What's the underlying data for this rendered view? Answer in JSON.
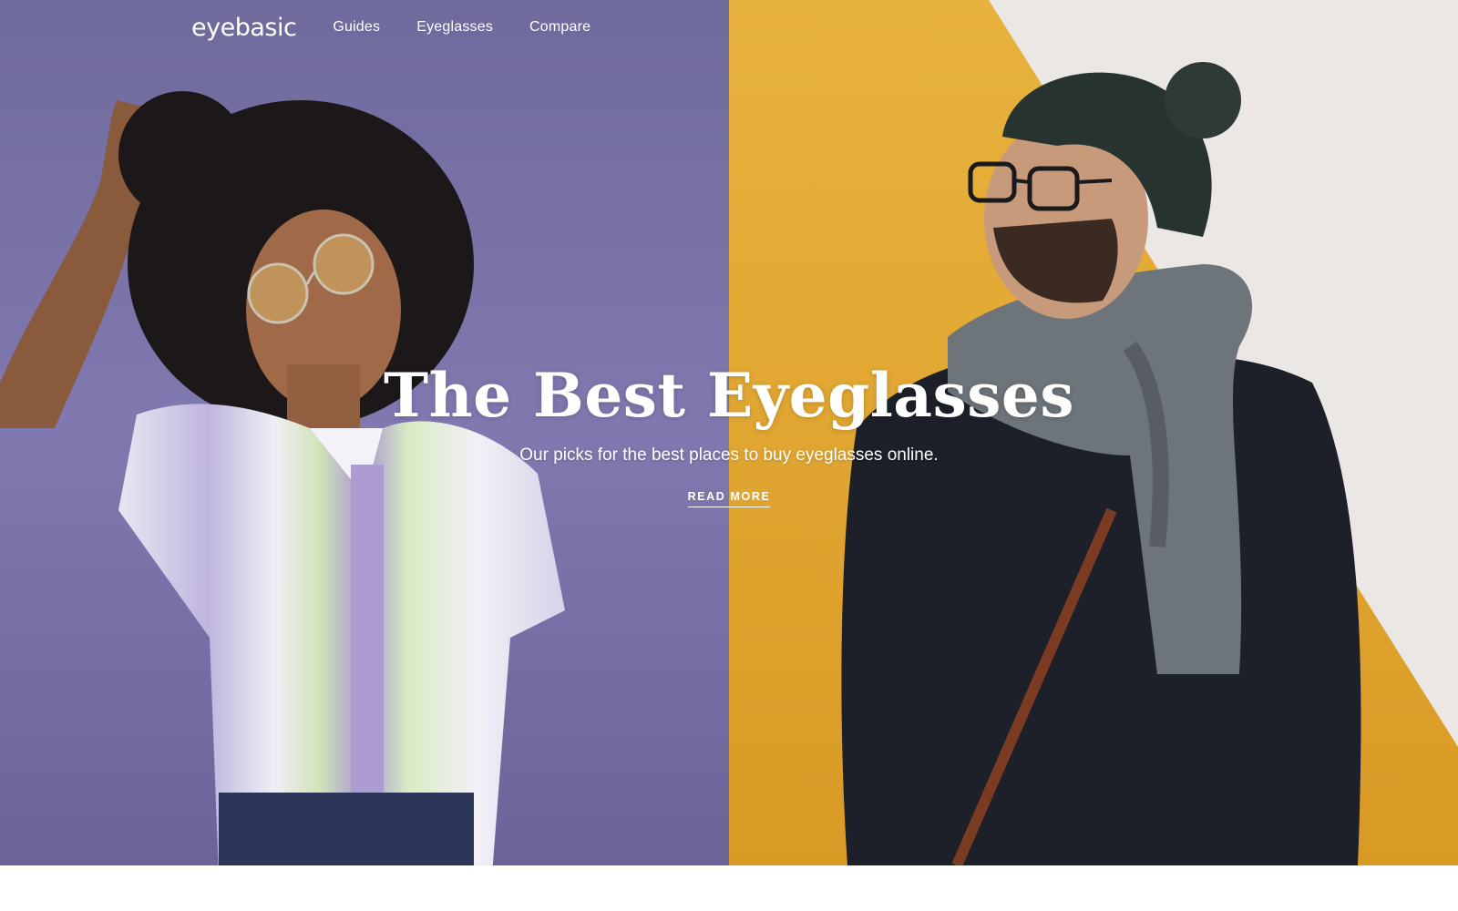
{
  "nav": {
    "logo": "eyebasic",
    "links": [
      "Guides",
      "Eyeglasses",
      "Compare"
    ]
  },
  "hero": {
    "title": "The Best Eyeglasses",
    "subtitle": "Our picks for the best places to buy eyeglasses online.",
    "cta": "READ MORE",
    "left_photo": "woman-with-round-glasses-photo",
    "right_photo": "man-with-beanie-and-scarf-photo"
  },
  "colors": {
    "left_bg": "#7c74a8",
    "right_bg": "#e6ad36",
    "wall_white": "#ece9e6",
    "text": "#ffffff"
  }
}
